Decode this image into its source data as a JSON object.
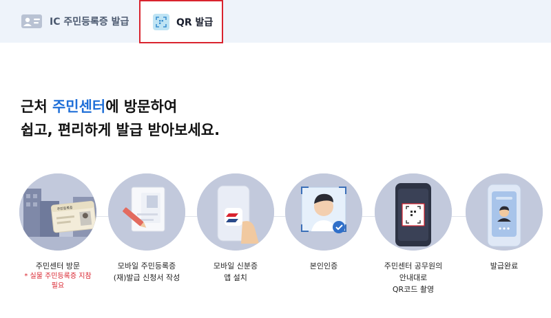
{
  "tabs": [
    {
      "label": "IC 주민등록증 발급",
      "icon": "id-card-icon",
      "active": false
    },
    {
      "label": "QR 발급",
      "icon": "qr-scan-icon",
      "active": true
    }
  ],
  "headline": {
    "line1_pre": "근처 ",
    "line1_highlight": "주민센터",
    "line1_post": "에 방문하여",
    "line2": "쉽고, 편리하게 발급 받아보세요."
  },
  "steps": [
    {
      "lines": [
        "주민센터 방문"
      ],
      "note": [
        "* 실물 주민등록증 지참",
        "필요"
      ],
      "card_text": "주민등록증"
    },
    {
      "lines": [
        "모바일 주민등록증",
        "(재)발급 신청서 작성"
      ]
    },
    {
      "lines": [
        "모바일 신분증",
        "앱 설치"
      ]
    },
    {
      "lines": [
        "본인인증"
      ]
    },
    {
      "lines": [
        "주민센터 공무원의",
        "안내대로",
        "QR코드 촬영"
      ]
    },
    {
      "lines": [
        "발급완료"
      ]
    }
  ],
  "colors": {
    "accent": "#1f6fd8",
    "alert": "#d9232e",
    "circle": "#c2c9dc",
    "tabbar": "#eef3fa"
  }
}
